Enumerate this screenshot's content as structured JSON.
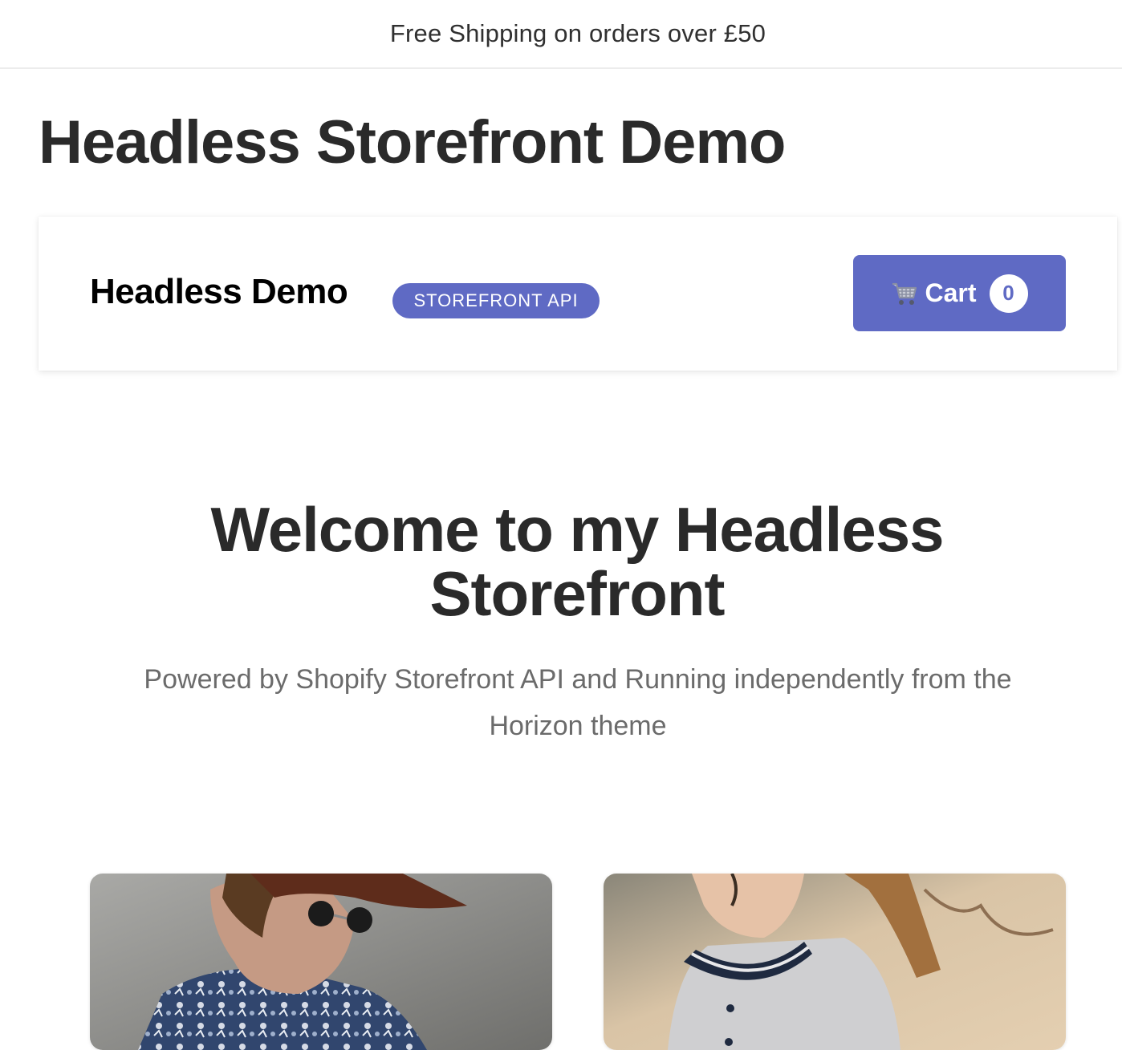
{
  "announcement": {
    "text": "Free Shipping on orders over £50"
  },
  "page": {
    "title": "Headless Storefront Demo"
  },
  "header": {
    "brand": "Headless Demo",
    "badge": "STOREFRONT API",
    "cart": {
      "label": "Cart",
      "count": "0",
      "icon": "shopping-cart-icon"
    }
  },
  "hero": {
    "title": "Welcome to my Headless Storefront",
    "subtitle": "Powered by Shopify Storefront API and Running independently from the Horizon theme"
  },
  "products": [
    {
      "image": "man-with-hat-and-sunglasses-photo"
    },
    {
      "image": "woman-in-varsity-jacket-photo"
    }
  ],
  "colors": {
    "accent": "#5f6ac4",
    "text": "#2a2a2a",
    "muted": "#6b6b6b"
  }
}
